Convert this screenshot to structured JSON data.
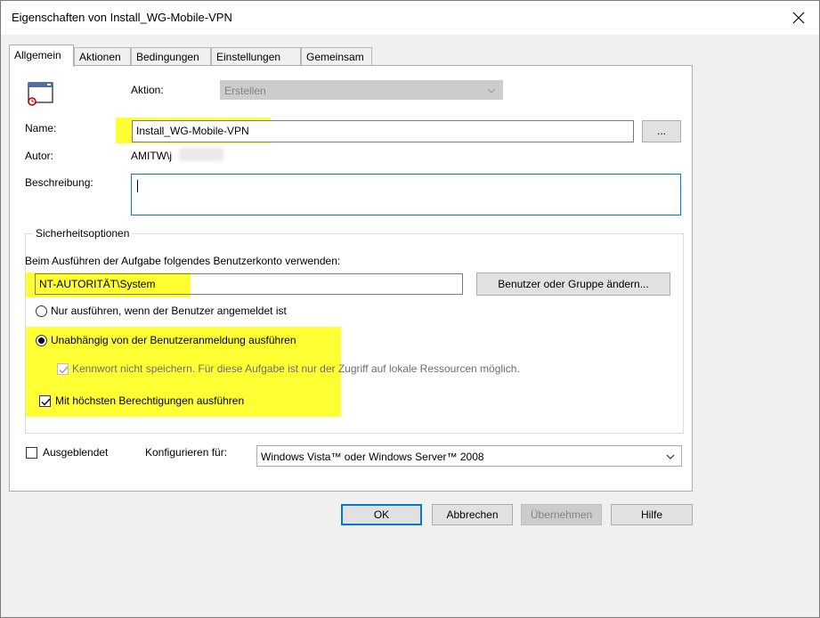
{
  "window": {
    "title": "Eigenschaften von Install_WG-Mobile-VPN"
  },
  "icons": {
    "close": "close-icon",
    "task": "task-scheduler-icon",
    "chevron": "chevron-down-icon"
  },
  "tabs": [
    {
      "label": "Allgemein",
      "active": true
    },
    {
      "label": "Aktionen"
    },
    {
      "label": "Bedingungen"
    },
    {
      "label": "Einstellungen"
    },
    {
      "label": "Gemeinsam"
    }
  ],
  "general": {
    "action_label": "Aktion:",
    "action_value": "Erstellen",
    "name_label": "Name:",
    "name_value": "Install_WG-Mobile-VPN",
    "browse_label": "...",
    "author_label": "Autor:",
    "author_value": "AMITW\\j",
    "description_label": "Beschreibung:",
    "description_value": ""
  },
  "security": {
    "legend": "Sicherheitsoptionen",
    "account_prompt": "Beim Ausführen der Aufgabe folgendes Benutzerkonto verwenden:",
    "account_value": "NT-AUTORITÄT\\System",
    "change_user_label": "Benutzer oder Gruppe ändern...",
    "radio_logged_on": "Nur ausführen, wenn der Benutzer angemeldet ist",
    "radio_independent": "Unabhängig von der Benutzeranmeldung ausführen",
    "selected_radio": "independent",
    "no_password_label": "Kennwort nicht speichern. Für diese Aufgabe ist nur der Zugriff auf lokale Ressourcen möglich.",
    "no_password_checked": true,
    "highest_privileges_label": "Mit höchsten Berechtigungen ausführen",
    "highest_privileges_checked": true
  },
  "bottom": {
    "hidden_label": "Ausgeblendet",
    "hidden_checked": false,
    "configure_label": "Konfigurieren für:",
    "configure_value": "Windows Vista™ oder Windows Server™ 2008"
  },
  "buttons": {
    "ok": "OK",
    "cancel": "Abbrechen",
    "apply": "Übernehmen",
    "help": "Hilfe"
  },
  "colors": {
    "highlight": "#ffff33",
    "focus_border": "#0078d7",
    "window_bg": "#f0f0f0"
  }
}
